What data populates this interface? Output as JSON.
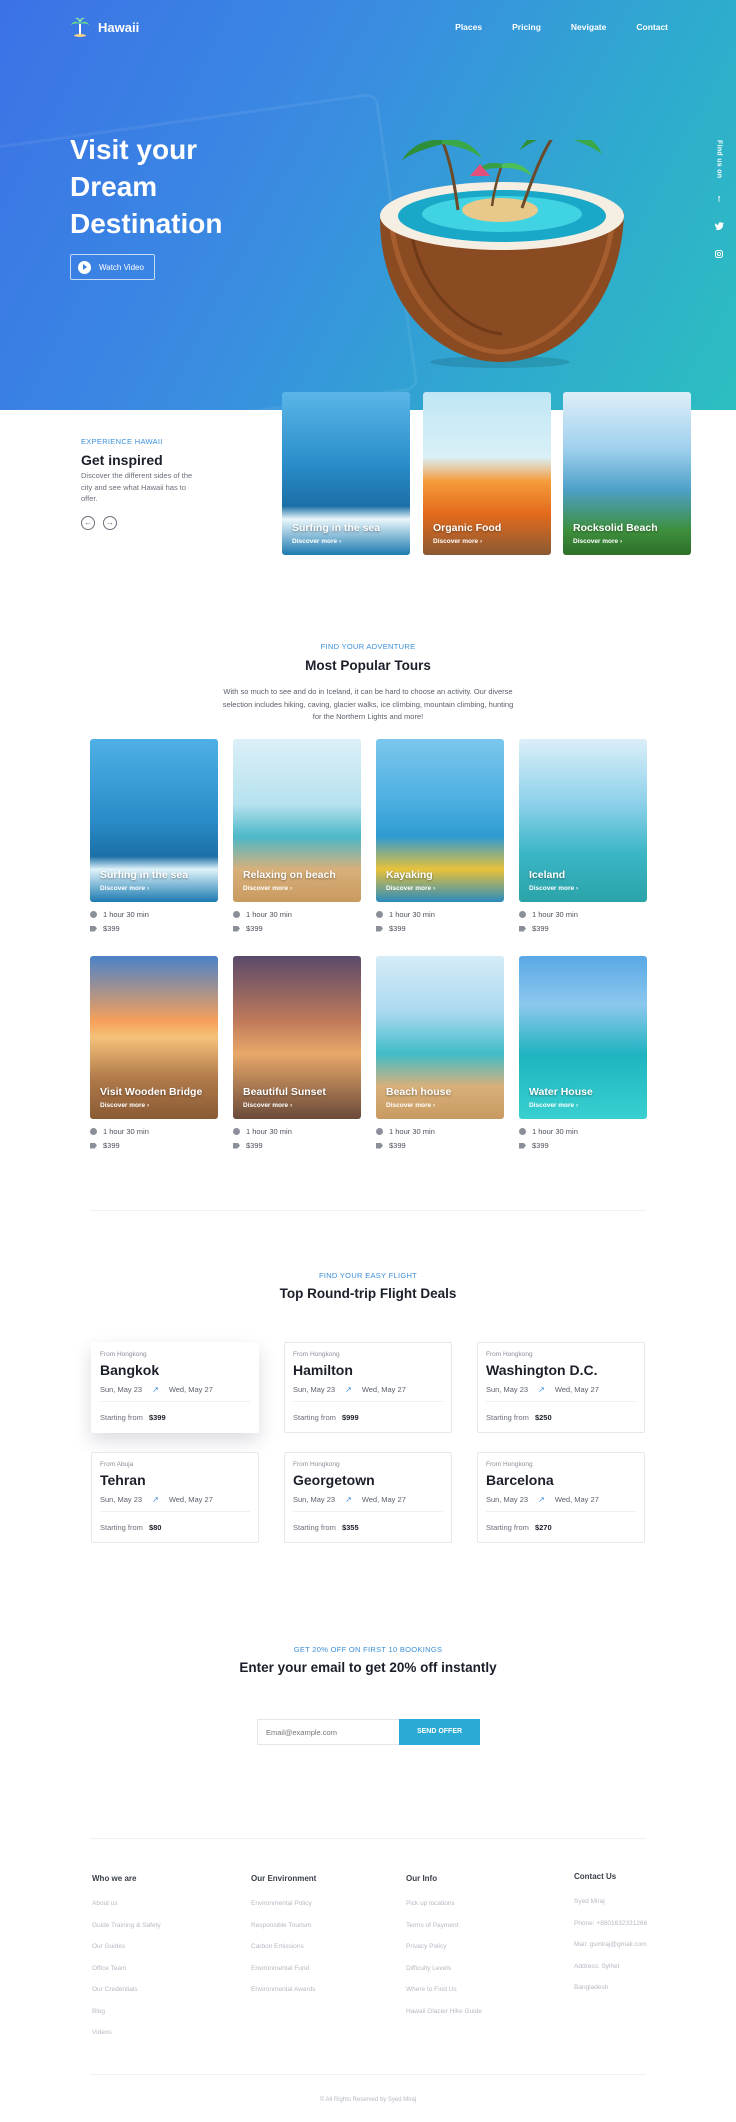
{
  "brand": {
    "name": "Hawaii"
  },
  "nav": [
    "Places",
    "Pricing",
    "Nevigate",
    "Contact"
  ],
  "hero": {
    "title_lines": [
      "Visit your",
      "Dream",
      "Destination"
    ],
    "watch_label": "Watch Video"
  },
  "side": {
    "find_us": "Find us on",
    "icons": [
      "facebook-icon",
      "twitter-icon",
      "instagram-icon"
    ]
  },
  "inspired": {
    "eyebrow": "EXPERIENCE HAWAII",
    "title": "Get inspired",
    "desc": "Discover the different sides of the city and see what Hawaii has to offer.",
    "cards": [
      {
        "title": "Surfing in the sea",
        "link": "Discover more"
      },
      {
        "title": "Organic Food",
        "link": "Discover more"
      },
      {
        "title": "Rocksolid Beach",
        "link": "Discover more"
      }
    ]
  },
  "tours": {
    "eyebrow": "FIND YOUR ADVENTURE",
    "title": "Most Popular Tours",
    "desc": "With so much to see and do in Iceland, it can be hard to choose an activity. Our diverse selection includes hiking, caving, glacier walks, ice climbing, mountain climbing, hunting for the Northern Lights and more!",
    "items": [
      {
        "title": "Surfing in the sea",
        "link": "Discover more",
        "duration": "1 hour 30 min",
        "price": "$399"
      },
      {
        "title": "Relaxing on beach",
        "link": "Discover more",
        "duration": "1 hour 30 min",
        "price": "$399"
      },
      {
        "title": "Kayaking",
        "link": "Discover more",
        "duration": "1 hour 30 min",
        "price": "$399"
      },
      {
        "title": "Iceland",
        "link": "Discover more",
        "duration": "1 hour 30 min",
        "price": "$399"
      },
      {
        "title": "Visit Wooden Bridge",
        "link": "Discover more",
        "duration": "1 hour 30 min",
        "price": "$399"
      },
      {
        "title": "Beautiful Sunset",
        "link": "Discover more",
        "duration": "1 hour 30 min",
        "price": "$399"
      },
      {
        "title": "Beach house",
        "link": "Discover more",
        "duration": "1 hour 30 min",
        "price": "$399"
      },
      {
        "title": "Water House",
        "link": "Discover more",
        "duration": "1 hour 30 min",
        "price": "$399"
      }
    ]
  },
  "flights": {
    "eyebrow": "FIND YOUR EASY FLIGHT",
    "title": "Top Round-trip Flight Deals",
    "items": [
      {
        "from": "From Hongkong",
        "city": "Bangkok",
        "depart": "Sun, May 23",
        "return": "Wed, May 27",
        "starting": "Starting from",
        "price": "$399"
      },
      {
        "from": "From Hongkong",
        "city": "Hamilton",
        "depart": "Sun, May 23",
        "return": "Wed, May 27",
        "starting": "Starting from",
        "price": "$999"
      },
      {
        "from": "From Hongkong",
        "city": "Washington D.C.",
        "depart": "Sun, May 23",
        "return": "Wed, May 27",
        "starting": "Starting from",
        "price": "$250"
      },
      {
        "from": "From Abuja",
        "city": "Tehran",
        "depart": "Sun, May 23",
        "return": "Wed, May 27",
        "starting": "Starting from",
        "price": "$80"
      },
      {
        "from": "From Hongkong",
        "city": "Georgetown",
        "depart": "Sun, May 23",
        "return": "Wed, May 27",
        "starting": "Starting from",
        "price": "$355"
      },
      {
        "from": "From Hongkong",
        "city": "Barcelona",
        "depart": "Sun, May 23",
        "return": "Wed, May 27",
        "starting": "Starting from",
        "price": "$270"
      }
    ]
  },
  "subscribe": {
    "eyebrow": "GET 20% OFF ON FIRST 10 BOOKINGS",
    "title": "Enter your email to get 20% off instantly",
    "placeholder": "Email@example.com",
    "button": "SEND OFFER"
  },
  "footer": {
    "columns": [
      {
        "heading": "Who we are",
        "links": [
          "About us",
          "Guide Training & Safety",
          "Our Guides",
          "Office Team",
          "Our Credentials",
          "Blog",
          "Videos"
        ]
      },
      {
        "heading": "Our Environment",
        "links": [
          "Environmental Policy",
          "Responsible Tourism",
          "Carbon Emissions",
          "Environmental Fund",
          "Environmental Awards"
        ]
      },
      {
        "heading": "Our Info",
        "links": [
          "Pick up locations",
          "Terms of Payment",
          "Privacy Policy",
          "Difficulty Levels",
          "Where to Find Us",
          "Hawaii Glacier Hike Guide"
        ]
      },
      {
        "heading": "Contact Us",
        "links": [
          "Syed Miraj",
          "Phone: +8801632331266",
          "Mail: gsmiraj@gmail.com",
          "Address: Sylhet",
          "Bangladesh"
        ]
      }
    ],
    "copyright": "© All Rights Reserved by Syed Miraj"
  },
  "colors": {
    "accent": "#3a8fd9",
    "button": "#2aaad4",
    "hero_start": "#3b72e6",
    "hero_end": "#2cbfc0"
  }
}
